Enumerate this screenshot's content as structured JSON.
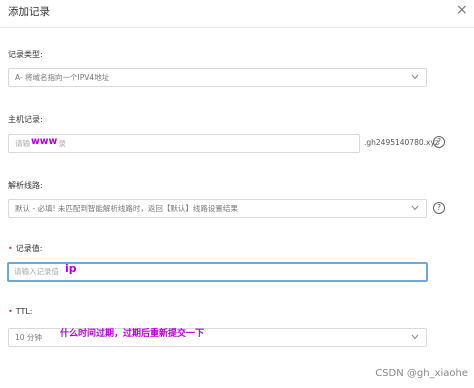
{
  "dialog": {
    "title": "添加记录",
    "close_glyph": "×"
  },
  "form": {
    "record_type": {
      "label": "记录类型:",
      "value": "A- 将域名指向一个IPV4地址"
    },
    "host_record": {
      "label": "主机记录:",
      "placeholder_prefix": "请输",
      "placeholder_suffix": "录",
      "domain_suffix": ".gh2495140780.xyz"
    },
    "resolution_line": {
      "label": "解析线路:",
      "value": "默认 - 必填! 未匹配到智能解析线路时，返回【默认】线路设置结果"
    },
    "record_value": {
      "required_mark": "•",
      "label": "记录值:",
      "placeholder": "请输入记录值"
    },
    "ttl": {
      "required_mark": "•",
      "label": "TTL:",
      "value": "10 分钟"
    },
    "help_glyph": "?"
  },
  "annotations": {
    "www": "www",
    "ip": "ip",
    "ttl_note": "什么时间过期，过期后重新提交一下"
  },
  "watermark": "CSDN @gh_xiaohe"
}
